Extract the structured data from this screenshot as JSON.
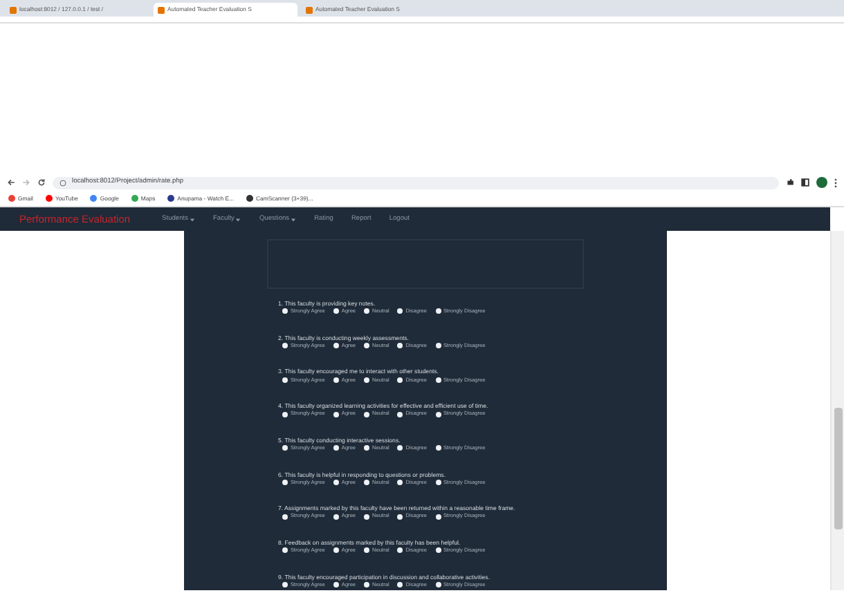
{
  "browser": {
    "tabs": [
      {
        "title": "localhost:8012 / 127.0.0.1 / test /",
        "selected": false
      },
      {
        "title": "Automated Teacher Evaluation S",
        "selected": true
      },
      {
        "title": "Automated Teacher Evaluation S",
        "selected": false
      }
    ],
    "url": "localhost:8012/Project/admin/rate.php",
    "bookmarks": [
      "Gmail",
      "YouTube",
      "Google",
      "Maps",
      "Anupama - Watch E...",
      "CamScanner (3+39)..."
    ]
  },
  "navbar": {
    "brand": "Performance Evaluation",
    "items": [
      {
        "label": "Students",
        "dropdown": true
      },
      {
        "label": "Faculty",
        "dropdown": true
      },
      {
        "label": "Questions",
        "dropdown": true
      },
      {
        "label": "Rating",
        "dropdown": false
      },
      {
        "label": "Report",
        "dropdown": false
      },
      {
        "label": "Logout",
        "dropdown": false
      }
    ]
  },
  "questions": [
    {
      "text": "1. This faculty is providing key notes.",
      "options": [
        {
          "label": "Strongly Agree",
          "selected": false
        },
        {
          "label": "Agree",
          "selected": false
        },
        {
          "label": "Neutral",
          "selected": false
        },
        {
          "label": "Disagree",
          "selected": false
        },
        {
          "label": "Strongly Disagree",
          "selected": false
        }
      ]
    },
    {
      "text": "2. This faculty is conducting weekly assessments.",
      "options": [
        {
          "label": "Strongly Agree",
          "selected": false
        },
        {
          "label": "Agree",
          "selected": false
        },
        {
          "label": "Neutral",
          "selected": false
        },
        {
          "label": "Disagree",
          "selected": false
        },
        {
          "label": "Strongly Disagree",
          "selected": false
        }
      ]
    },
    {
      "text": "3. This faculty encouraged me to interact with other students.",
      "options": [
        {
          "label": "Strongly Agree",
          "selected": false
        },
        {
          "label": "Agree",
          "selected": false
        },
        {
          "label": "Neutral",
          "selected": false
        },
        {
          "label": "Disagree",
          "selected": false
        },
        {
          "label": "Strongly Disagree",
          "selected": false
        }
      ]
    },
    {
      "text": "4. This faculty organized learning activities for effective and efficient use of time.",
      "options": [
        {
          "label": "Strongly Agree",
          "selected": false
        },
        {
          "label": "Agree",
          "selected": false
        },
        {
          "label": "Neutral",
          "selected": false
        },
        {
          "label": "Disagree",
          "selected": false
        },
        {
          "label": "Strongly Disagree",
          "selected": false
        }
      ]
    },
    {
      "text": "5. This faculty conducting interactive sessions.",
      "options": [
        {
          "label": "Strongly Agree",
          "selected": false
        },
        {
          "label": "Agree",
          "selected": false
        },
        {
          "label": "Neutral",
          "selected": false
        },
        {
          "label": "Disagree",
          "selected": false
        },
        {
          "label": "Strongly Disagree",
          "selected": false
        }
      ]
    },
    {
      "text": "6. This faculty is helpful in responding to questions or problems.",
      "options": [
        {
          "label": "Strongly Agree",
          "selected": false
        },
        {
          "label": "Agree",
          "selected": false
        },
        {
          "label": "Neutral",
          "selected": false
        },
        {
          "label": "Disagree",
          "selected": false
        },
        {
          "label": "Strongly Disagree",
          "selected": false
        }
      ]
    },
    {
      "text": "7. Assignments marked by this faculty have been returned within a reasonable time frame.",
      "options": [
        {
          "label": "Strongly Agree",
          "selected": false
        },
        {
          "label": "Agree",
          "selected": false
        },
        {
          "label": "Neutral",
          "selected": false
        },
        {
          "label": "Disagree",
          "selected": false
        },
        {
          "label": "Strongly Disagree",
          "selected": false
        }
      ]
    },
    {
      "text": "8. Feedback on assignments marked by this faculty has been helpful.",
      "options": [
        {
          "label": "Strongly Agree",
          "selected": false
        },
        {
          "label": "Agree",
          "selected": false
        },
        {
          "label": "Neutral",
          "selected": false
        },
        {
          "label": "Disagree",
          "selected": false
        },
        {
          "label": "Strongly Disagree",
          "selected": false
        }
      ]
    },
    {
      "text": "9. This faculty encouraged participation in discussion and collaborative activities.",
      "options": [
        {
          "label": "Strongly Agree",
          "selected": false
        },
        {
          "label": "Agree",
          "selected": false
        },
        {
          "label": "Neutral",
          "selected": false
        },
        {
          "label": "Disagree",
          "selected": false
        },
        {
          "label": "Strongly Disagree",
          "selected": false
        }
      ]
    }
  ]
}
